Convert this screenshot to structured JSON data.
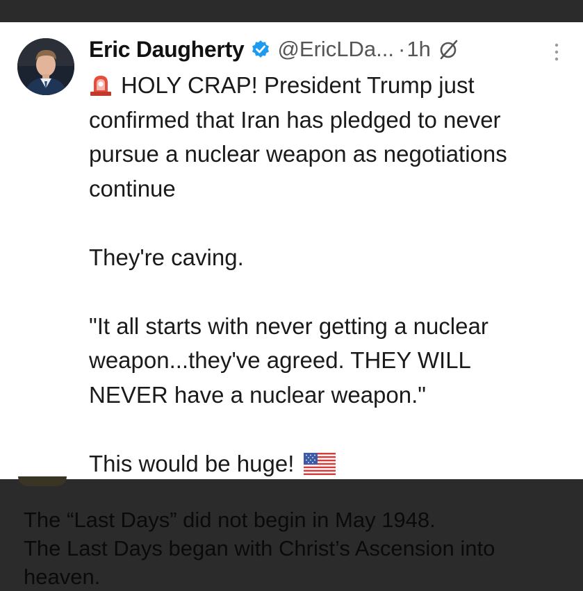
{
  "post": {
    "author_name": "Eric Daugherty",
    "handle": "@EricLDa...",
    "separator": "·",
    "time": "1h",
    "lines": {
      "line1": "HOLY CRAP! President Trump just",
      "line2": "confirmed that Iran has pledged to never",
      "line3": "pursue a nuclear weapon as negotiations",
      "line4": "continue",
      "line5": "They're caving.",
      "line6": "\"It all starts with never getting a nuclear",
      "line7": "weapon...they've agreed. THEY WILL",
      "line8": "NEVER have a nuclear weapon.\"",
      "line9": "This would be huge!"
    },
    "icons": {
      "verified": "verified-badge-icon",
      "grok": "grok-icon",
      "more": "more-options-icon",
      "siren": "rotating-light-emoji-icon",
      "flag": "us-flag-emoji-icon"
    }
  },
  "lower_post": {
    "line1": "The “Last Days” did not begin in May 1948.",
    "line2": "The Last Days began with Christ’s Ascension into",
    "line3": "heaven."
  },
  "colors": {
    "background": "#2b2b2b",
    "card": "#ffffff",
    "verified_blue": "#1d9bf0",
    "text": "#1a1a1a",
    "muted": "#555555"
  }
}
